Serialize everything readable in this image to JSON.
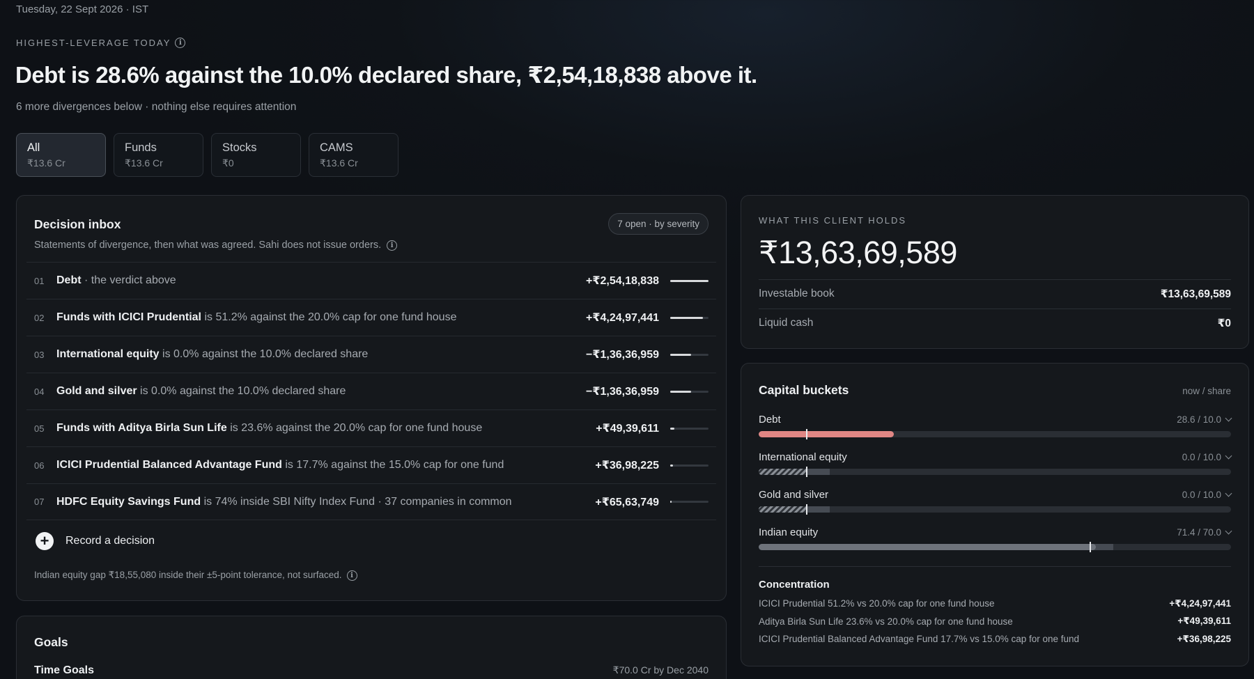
{
  "date": "Tuesday, 22 Sept 2026 · IST",
  "eyebrow": "HIGHEST-LEVERAGE TODAY",
  "headline": "Debt is 28.6% against the 10.0% declared share, ₹2,54,18,838 above it.",
  "subline": "6 more divergences below · nothing else requires attention",
  "filters": [
    {
      "label": "All",
      "value": "₹13.6 Cr"
    },
    {
      "label": "Funds",
      "value": "₹13.6 Cr"
    },
    {
      "label": "Stocks",
      "value": "₹0"
    },
    {
      "label": "CAMS",
      "value": "₹13.6 Cr"
    }
  ],
  "inbox": {
    "title": "Decision inbox",
    "pill": "7 open · by severity",
    "subtitle": "Statements of divergence, then what was agreed. Sahi does not issue orders.",
    "rows": [
      {
        "num": "01",
        "bold": "Debt",
        "rest": " · the verdict above",
        "amount": "+₹2,54,18,838",
        "severity": 1.0
      },
      {
        "num": "02",
        "bold": "Funds with ICICI Prudential",
        "rest": " is 51.2% against the 20.0% cap for one fund house",
        "amount": "+₹4,24,97,441",
        "severity": 0.85
      },
      {
        "num": "03",
        "bold": "International equity",
        "rest": " is 0.0% against the 10.0% declared share",
        "amount": "−₹1,36,36,959",
        "severity": 0.55
      },
      {
        "num": "04",
        "bold": "Gold and silver",
        "rest": " is 0.0% against the 10.0% declared share",
        "amount": "−₹1,36,36,959",
        "severity": 0.55
      },
      {
        "num": "05",
        "bold": "Funds with Aditya Birla Sun Life",
        "rest": " is 23.6% against the 20.0% cap for one fund house",
        "amount": "+₹49,39,611",
        "severity": 0.1
      },
      {
        "num": "06",
        "bold": "ICICI Prudential Balanced Advantage Fund",
        "rest": " is 17.7% against the 15.0% cap for one fund",
        "amount": "+₹36,98,225",
        "severity": 0.08
      },
      {
        "num": "07",
        "bold": "HDFC Equity Savings Fund",
        "rest": " is 74% inside SBI Nifty Index Fund · 37 companies in common",
        "amount": "+₹65,63,749",
        "severity": 0.03
      }
    ],
    "record_label": "Record a decision",
    "footnote": "Indian equity gap ₹18,55,080 inside their ±5-point tolerance, not surfaced."
  },
  "goals": {
    "title": "Goals",
    "row_label": "Time Goals",
    "row_value": "₹70.0 Cr by Dec 2040"
  },
  "holds": {
    "eyebrow": "WHAT THIS CLIENT HOLDS",
    "total": "₹13,63,69,589",
    "rows": [
      {
        "label": "Investable book",
        "value": "₹13,63,69,589"
      },
      {
        "label": "Liquid cash",
        "value": "₹0"
      }
    ]
  },
  "buckets": {
    "title": "Capital buckets",
    "header_right": "now / share",
    "items": [
      {
        "label": "Debt",
        "ratio": "28.6 / 10.0",
        "now": 28.6,
        "share": 10.0
      },
      {
        "label": "International equity",
        "ratio": "0.0 / 10.0",
        "now": 0.0,
        "share": 10.0
      },
      {
        "label": "Gold and silver",
        "ratio": "0.0 / 10.0",
        "now": 0.0,
        "share": 10.0
      },
      {
        "label": "Indian equity",
        "ratio": "71.4 / 70.0",
        "now": 71.4,
        "share": 70.0
      }
    ],
    "concentration_title": "Concentration",
    "concentration": [
      {
        "label": "ICICI Prudential 51.2% vs 20.0% cap for one fund house",
        "value": "+₹4,24,97,441"
      },
      {
        "label": "Aditya Birla Sun Life 23.6% vs 20.0% cap for one fund house",
        "value": "+₹49,39,611"
      },
      {
        "label": "ICICI Prudential Balanced Advantage Fund 17.7% vs 15.0% cap for one fund",
        "value": "+₹36,98,225"
      }
    ]
  },
  "colors": {
    "over": "#e08684",
    "background": "#0e1116",
    "card": "#15181c"
  },
  "icons": {
    "info": "info-circle-icon",
    "plus": "plus-circle-icon",
    "chevron": "chevron-down-icon"
  }
}
